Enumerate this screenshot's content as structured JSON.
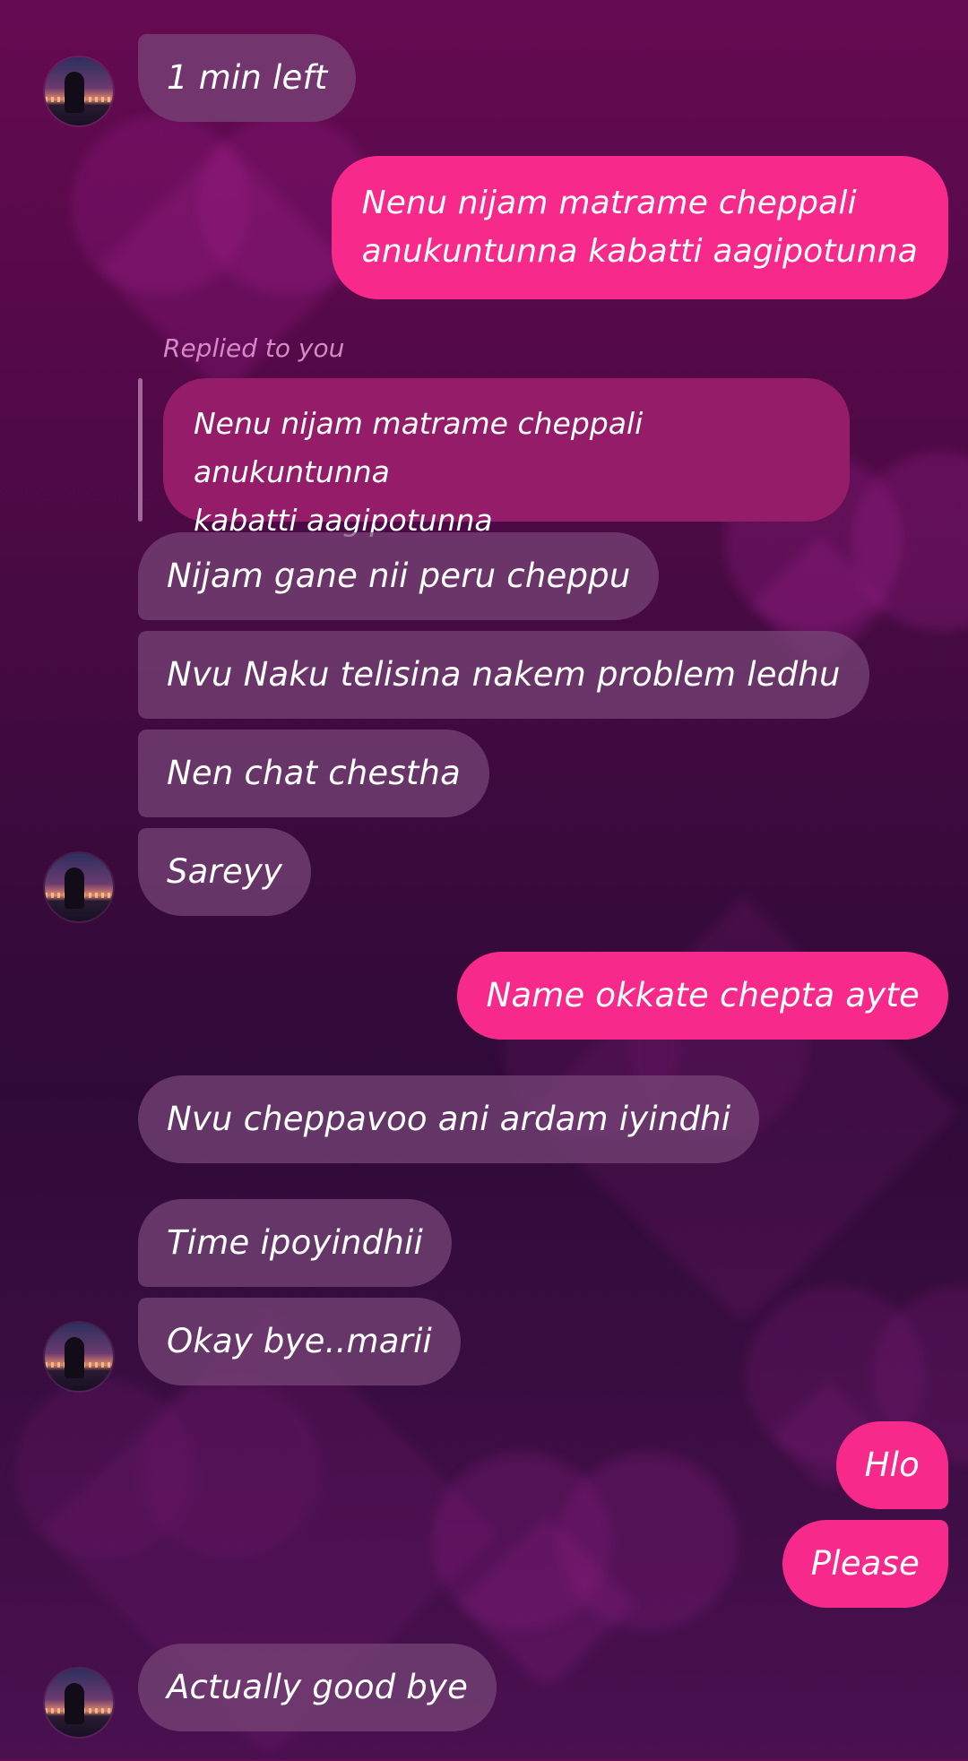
{
  "theme": {
    "incoming_bubble": "#7a4679",
    "outgoing_bubble": "#f72a8c",
    "quoted_bubble": "#941c69",
    "reply_label_color": "#d58ac6"
  },
  "messages": [
    {
      "dir": "in",
      "text": "1 min left"
    },
    {
      "dir": "out",
      "line1": "Nenu nijam matrame cheppali",
      "line2": "anukuntunna kabatti aagipotunna"
    },
    {
      "reply_label": "Replied to you",
      "quoted_line1": "Nenu nijam matrame cheppali anukuntunna",
      "quoted_line2": "kabatti aagipotunna"
    },
    {
      "dir": "in",
      "text": "Nijam gane nii peru cheppu"
    },
    {
      "dir": "in",
      "text": "Nvu Naku telisina nakem problem ledhu"
    },
    {
      "dir": "in",
      "text": "Nen chat chestha"
    },
    {
      "dir": "in",
      "text": "Sareyy"
    },
    {
      "dir": "out",
      "text": "Name okkate chepta ayte"
    },
    {
      "dir": "in",
      "text": "Nvu cheppavoo ani ardam iyindhi"
    },
    {
      "dir": "in",
      "text": "Time ipoyindhii"
    },
    {
      "dir": "in",
      "text": "Okay bye..marii"
    },
    {
      "dir": "out",
      "text": "Hlo"
    },
    {
      "dir": "out",
      "text": "Please"
    },
    {
      "dir": "in",
      "text": "Actually good bye"
    }
  ]
}
